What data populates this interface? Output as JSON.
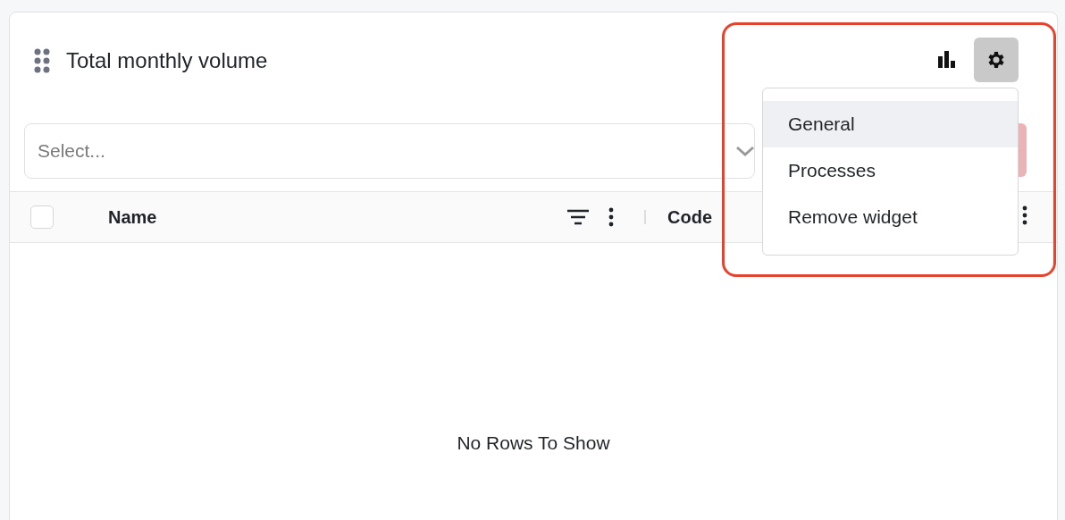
{
  "widget": {
    "title": "Total monthly volume"
  },
  "settings_button": {
    "active": true
  },
  "select": {
    "placeholder": "Select..."
  },
  "table": {
    "header_checkbox": {
      "checked": false
    },
    "columns": [
      {
        "label": "Name"
      },
      {
        "label": "Code"
      }
    ],
    "empty_message": "No Rows To Show"
  },
  "menu": {
    "items": [
      {
        "label": "General",
        "selected": true
      },
      {
        "label": "Processes",
        "selected": false
      },
      {
        "label": "Remove widget",
        "selected": false
      }
    ]
  }
}
